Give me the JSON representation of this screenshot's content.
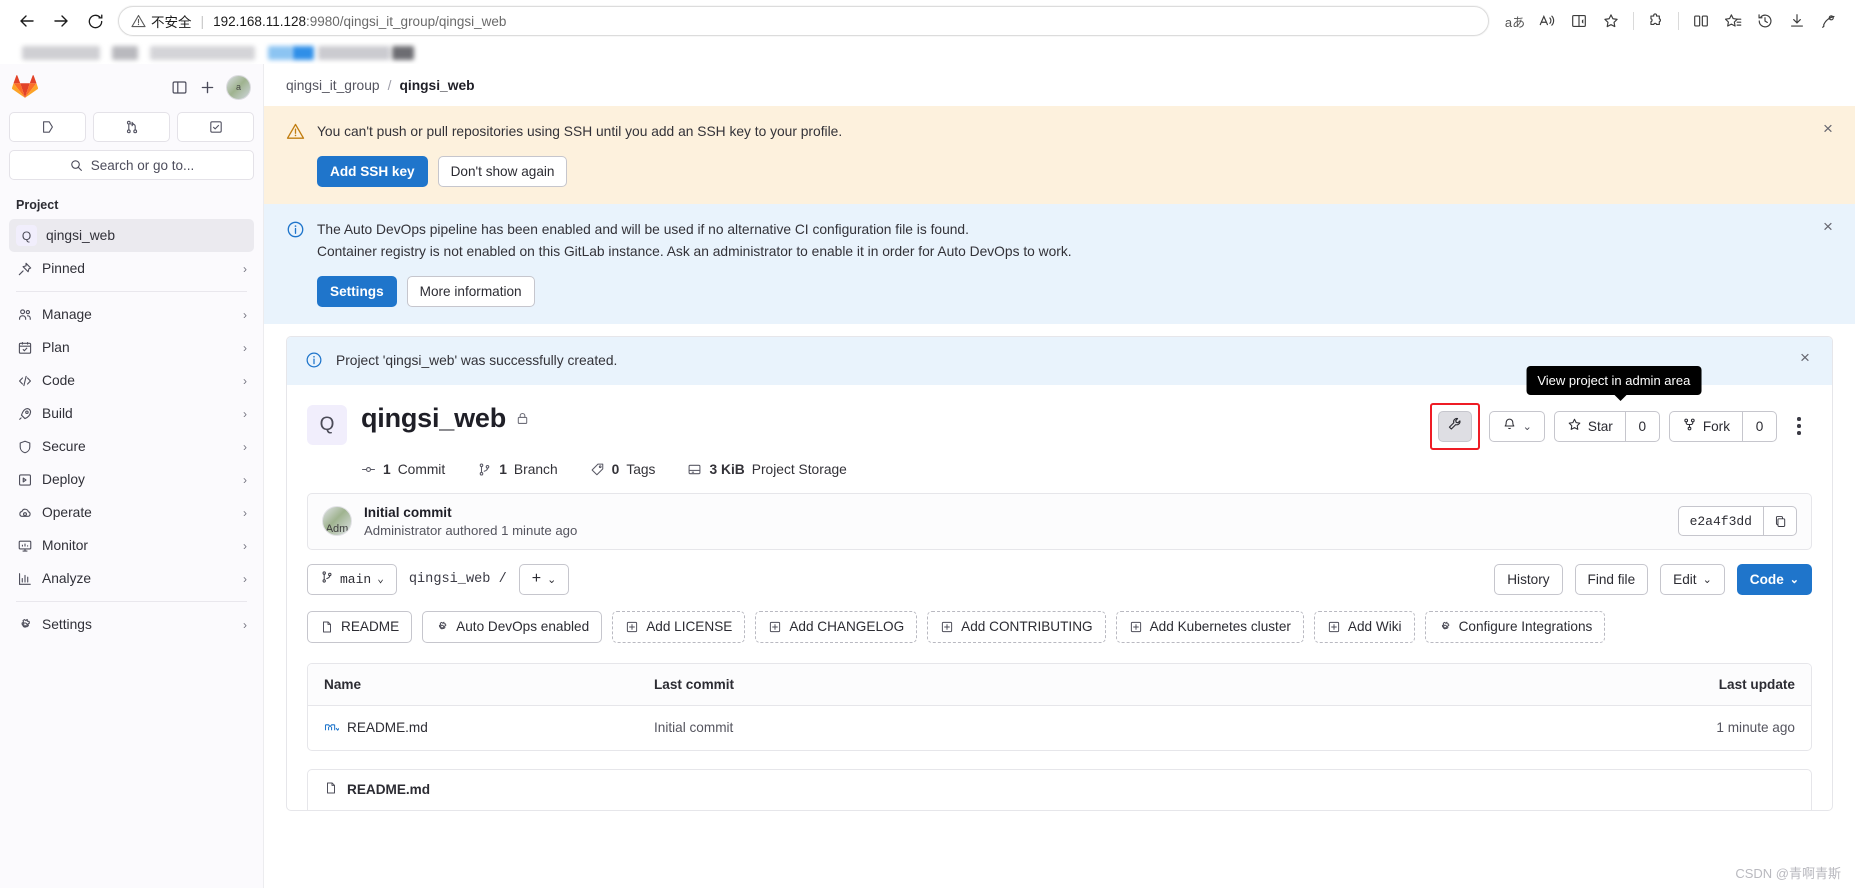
{
  "browser": {
    "nav": {
      "back": "back-arrow",
      "forward": "forward-arrow",
      "reload": "reload-icon"
    },
    "security_label": "不安全",
    "url_host": "192.168.11.128",
    "url_rest": ":9980/qingsi_it_group/qingsi_web",
    "toolbar_icons": [
      "read-aloud-japanese",
      "read-aloud",
      "immersive-reader",
      "favorite-star",
      "extensions",
      "split-screen",
      "collections",
      "history",
      "downloads",
      "browser-essentials"
    ]
  },
  "sidebar": {
    "logo": "gitlab-logo",
    "top_buttons": [
      "toggle-sidebar-icon",
      "create-new-icon"
    ],
    "avatar_label": "a",
    "shortcuts": [
      "issues-icon",
      "merge-requests-icon",
      "todos-icon"
    ],
    "search_placeholder": "Search or go to...",
    "section_heading": "Project",
    "project": {
      "badge": "Q",
      "label": "qingsi_web"
    },
    "items": [
      {
        "label": "Pinned",
        "icon": "pin-icon",
        "chevron": "›"
      },
      {
        "label": "Manage",
        "icon": "users-icon",
        "chevron": "›"
      },
      {
        "label": "Plan",
        "icon": "calendar-icon",
        "chevron": "›"
      },
      {
        "label": "Code",
        "icon": "code-icon",
        "chevron": "›"
      },
      {
        "label": "Build",
        "icon": "rocket-icon",
        "chevron": "›"
      },
      {
        "label": "Secure",
        "icon": "shield-icon",
        "chevron": "›"
      },
      {
        "label": "Deploy",
        "icon": "deploy-icon",
        "chevron": "›"
      },
      {
        "label": "Operate",
        "icon": "cloud-gear-icon",
        "chevron": "›"
      },
      {
        "label": "Monitor",
        "icon": "monitor-icon",
        "chevron": "›"
      },
      {
        "label": "Analyze",
        "icon": "chart-icon",
        "chevron": "›"
      },
      {
        "label": "Settings",
        "icon": "gear-icon",
        "chevron": "›"
      }
    ]
  },
  "breadcrumb": {
    "group": "qingsi_it_group",
    "separator": "/",
    "current": "qingsi_web"
  },
  "alerts": [
    {
      "type": "warning",
      "icon": "warning-triangle-icon",
      "text": "You can't push or pull repositories using SSH until you add an SSH key to your profile.",
      "primary_action": "Add SSH key",
      "secondary_action": "Don't show again",
      "close": "×"
    },
    {
      "type": "info",
      "icon": "info-circle-icon",
      "line1": "The Auto DevOps pipeline has been enabled and will be used if no alternative CI configuration file is found.",
      "line2": "Container registry is not enabled on this GitLab instance. Ask an administrator to enable it in order for Auto DevOps to work.",
      "primary_action": "Settings",
      "secondary_action": "More information",
      "close": "×"
    }
  ],
  "success_banner": {
    "icon": "info-circle-icon",
    "text": "Project 'qingsi_web' was successfully created.",
    "close": "×"
  },
  "project": {
    "avatar": "Q",
    "name": "qingsi_web",
    "visibility_icon": "lock-icon",
    "tooltip": "View project in admin area",
    "admin_button": "wrench-icon",
    "notification_button": "bell-icon",
    "star_label": "Star",
    "star_count": "0",
    "fork_label": "Fork",
    "fork_count": "0",
    "more_actions": "kebab-menu",
    "stats": [
      {
        "icon": "commit-icon",
        "value": "1",
        "label": "Commit"
      },
      {
        "icon": "branch-icon",
        "value": "1",
        "label": "Branch"
      },
      {
        "icon": "tag-icon",
        "value": "0",
        "label": "Tags"
      },
      {
        "icon": "storage-icon",
        "value": "3 KiB",
        "label": "Project Storage"
      }
    ]
  },
  "last_commit": {
    "title": "Initial commit",
    "subtitle": "Administrator authored 1 minute ago",
    "sha": "e2a4f3dd",
    "copy_icon": "copy-icon",
    "avatar_label": "Adm"
  },
  "file_toolbar": {
    "branch": "main",
    "branch_icon": "branch-icon",
    "branch_caret": "⌄",
    "path": "qingsi_web",
    "path_sep": "/",
    "add_label": "+",
    "add_caret": "⌄",
    "history": "History",
    "find_file": "Find file",
    "edit": "Edit",
    "edit_caret": "⌄",
    "code": "Code",
    "code_caret": "⌄"
  },
  "quick_actions": [
    {
      "label": "README",
      "icon": "file-icon",
      "style": "solid"
    },
    {
      "label": "Auto DevOps enabled",
      "icon": "gear-icon",
      "style": "solid"
    },
    {
      "label": "Add LICENSE",
      "icon": "plus-box-icon",
      "style": "dashed"
    },
    {
      "label": "Add CHANGELOG",
      "icon": "plus-box-icon",
      "style": "dashed"
    },
    {
      "label": "Add CONTRIBUTING",
      "icon": "plus-box-icon",
      "style": "dashed"
    },
    {
      "label": "Add Kubernetes cluster",
      "icon": "plus-box-icon",
      "style": "dashed"
    },
    {
      "label": "Add Wiki",
      "icon": "plus-box-icon",
      "style": "dashed"
    },
    {
      "label": "Configure Integrations",
      "icon": "gear-icon",
      "style": "dashed"
    }
  ],
  "files": {
    "columns": {
      "name": "Name",
      "last_commit": "Last commit",
      "last_update": "Last update"
    },
    "rows": [
      {
        "name": "README.md",
        "icon": "markdown-icon",
        "last_commit": "Initial commit",
        "last_update": "1 minute ago"
      }
    ]
  },
  "readme_panel": {
    "icon": "file-icon",
    "title": "README.md"
  },
  "watermark": "CSDN @青啊青斯",
  "colors": {
    "accent": "#1f75cb",
    "warning_bg": "#fdf1dd",
    "info_bg": "#e9f3fc",
    "highlight": "#ee1c25"
  }
}
